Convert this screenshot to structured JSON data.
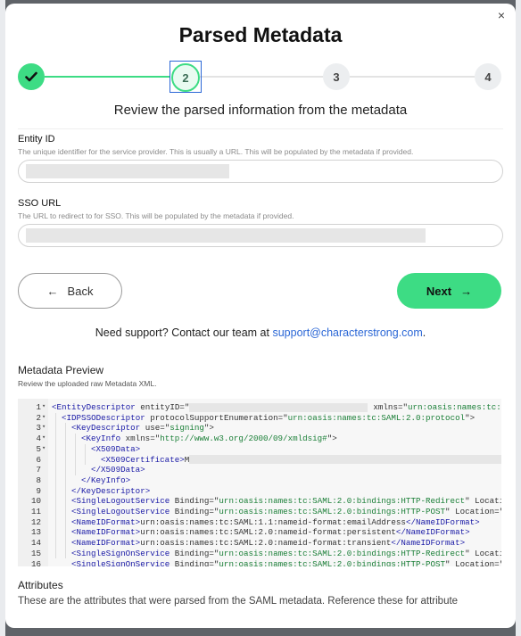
{
  "modal": {
    "title": "Parsed Metadata",
    "close_icon": "×",
    "subtitle": "Review the parsed information from the metadata"
  },
  "stepper": {
    "steps": [
      {
        "label": "✓",
        "state": "complete"
      },
      {
        "label": "2",
        "state": "current"
      },
      {
        "label": "3",
        "state": "upcoming"
      },
      {
        "label": "4",
        "state": "upcoming"
      }
    ],
    "colors": {
      "complete": "#3ddc84",
      "current_ring": "#3ddc84",
      "upcoming": "#eceef0"
    }
  },
  "entity_id": {
    "label": "Entity ID",
    "help": "The unique identifier for the service provider. This is usually a URL. This will be populated by the metadata if provided.",
    "value": ""
  },
  "sso_url": {
    "label": "SSO URL",
    "help": "The URL to redirect to for SSO. This will be populated by the metadata if provided.",
    "value": ""
  },
  "buttons": {
    "back_label": "Back",
    "back_icon": "←",
    "next_label": "Next",
    "next_icon": "→",
    "next_color": "#3ddc84"
  },
  "support": {
    "text": "Need support? Contact our team at",
    "email": "support@characterstrong.com",
    "suffix": "."
  },
  "metadata_preview": {
    "title": "Metadata Preview",
    "help": "Review the uploaded raw Metadata XML.",
    "lines": [
      {
        "n": "1",
        "fold": "▾",
        "indent": 0,
        "parts": [
          [
            "tag",
            "<EntityDescriptor"
          ],
          [
            "attr",
            " entityID=\""
          ],
          [
            "redacted",
            ""
          ],
          [
            "attr",
            "xmlns=\""
          ],
          [
            "str",
            "urn:oasis:names:tc:SAM"
          ]
        ]
      },
      {
        "n": "2",
        "fold": "▾",
        "indent": 1,
        "parts": [
          [
            "tag",
            "<IDPSSODescriptor"
          ],
          [
            "attr",
            " protocolSupportEnumeration=\""
          ],
          [
            "str",
            "urn:oasis:names:tc:SAML:2.0:protocol"
          ],
          [
            "attr",
            "\">"
          ]
        ]
      },
      {
        "n": "3",
        "fold": "▾",
        "indent": 2,
        "parts": [
          [
            "tag",
            "<KeyDescriptor"
          ],
          [
            "attr",
            " use=\""
          ],
          [
            "str",
            "signing"
          ],
          [
            "attr",
            "\">"
          ]
        ]
      },
      {
        "n": "4",
        "fold": "▾",
        "indent": 3,
        "parts": [
          [
            "tag",
            "<KeyInfo"
          ],
          [
            "attr",
            " xmlns=\""
          ],
          [
            "str",
            "http://www.w3.org/2000/09/xmldsig#"
          ],
          [
            "attr",
            "\">"
          ]
        ]
      },
      {
        "n": "5",
        "fold": "▾",
        "indent": 4,
        "parts": [
          [
            "tag",
            "<X509Data>"
          ]
        ]
      },
      {
        "n": "6",
        "fold": "",
        "indent": 5,
        "parts": [
          [
            "tag",
            "<X509Certificate>"
          ],
          [
            "attr",
            "M"
          ],
          [
            "redacted",
            ""
          ]
        ]
      },
      {
        "n": "7",
        "fold": "",
        "indent": 4,
        "parts": [
          [
            "tag",
            "</X509Data>"
          ]
        ]
      },
      {
        "n": "8",
        "fold": "",
        "indent": 3,
        "parts": [
          [
            "tag",
            "</KeyInfo>"
          ]
        ]
      },
      {
        "n": "9",
        "fold": "",
        "indent": 2,
        "parts": [
          [
            "tag",
            "</KeyDescriptor>"
          ]
        ]
      },
      {
        "n": "10",
        "fold": "",
        "indent": 2,
        "parts": [
          [
            "tag",
            "<SingleLogoutService"
          ],
          [
            "attr",
            " Binding=\""
          ],
          [
            "str",
            "urn:oasis:names:tc:SAML:2.0:bindings:HTTP-Redirect"
          ],
          [
            "attr",
            "\" Location='"
          ]
        ]
      },
      {
        "n": "11",
        "fold": "",
        "indent": 2,
        "parts": [
          [
            "tag",
            "<SingleLogoutService"
          ],
          [
            "attr",
            " Binding=\""
          ],
          [
            "str",
            "urn:oasis:names:tc:SAML:2.0:bindings:HTTP-POST"
          ],
          [
            "attr",
            "\" Location=\""
          ],
          [
            "str",
            "http"
          ]
        ]
      },
      {
        "n": "12",
        "fold": "",
        "indent": 2,
        "parts": [
          [
            "tag",
            "<NameIDFormat>"
          ],
          [
            "attr",
            "urn:oasis:names:tc:SAML:1.1:nameid-format:emailAddress"
          ],
          [
            "tag",
            "</NameIDFormat>"
          ]
        ]
      },
      {
        "n": "13",
        "fold": "",
        "indent": 2,
        "parts": [
          [
            "tag",
            "<NameIDFormat>"
          ],
          [
            "attr",
            "urn:oasis:names:tc:SAML:2.0:nameid-format:persistent"
          ],
          [
            "tag",
            "</NameIDFormat>"
          ]
        ]
      },
      {
        "n": "14",
        "fold": "",
        "indent": 2,
        "parts": [
          [
            "tag",
            "<NameIDFormat>"
          ],
          [
            "attr",
            "urn:oasis:names:tc:SAML:2.0:nameid-format:transient"
          ],
          [
            "tag",
            "</NameIDFormat>"
          ]
        ]
      },
      {
        "n": "15",
        "fold": "",
        "indent": 2,
        "parts": [
          [
            "tag",
            "<SingleSignOnService"
          ],
          [
            "attr",
            " Binding=\""
          ],
          [
            "str",
            "urn:oasis:names:tc:SAML:2.0:bindings:HTTP-Redirect"
          ],
          [
            "attr",
            "\" Location='"
          ]
        ]
      },
      {
        "n": "16",
        "fold": "",
        "indent": 2,
        "parts": [
          [
            "tag",
            "<SingleSignOnService"
          ],
          [
            "attr",
            " Binding=\""
          ],
          [
            "str",
            "urn:oasis:names:tc:SAML:2.0:bindings:HTTP-POST"
          ],
          [
            "attr",
            "\" Location=\""
          ],
          [
            "str",
            "http"
          ]
        ]
      }
    ]
  },
  "attributes": {
    "title": "Attributes",
    "help": "These are the attributes that were parsed from the SAML metadata. Reference these for attribute"
  }
}
